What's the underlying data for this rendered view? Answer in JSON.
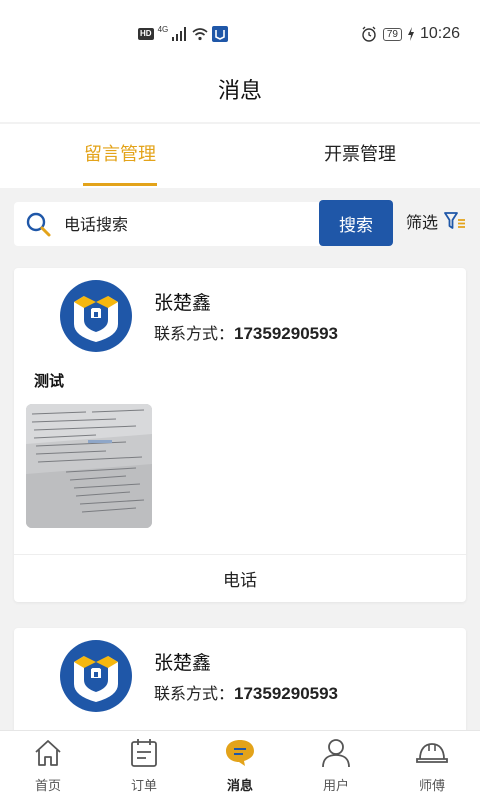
{
  "status_bar": {
    "hd": "HD",
    "network": "4G",
    "battery": "79",
    "time": "10:26"
  },
  "header": {
    "title": "消息"
  },
  "tabs": [
    {
      "label": "留言管理",
      "active": true
    },
    {
      "label": "开票管理",
      "active": false
    }
  ],
  "search": {
    "placeholder": "电话搜索",
    "button_label": "搜索",
    "filter_label": "筛选"
  },
  "cards": [
    {
      "name": "张楚鑫",
      "contact_label": "联系方式：",
      "phone": "17359290593",
      "message": "测试",
      "call_label": "电话"
    },
    {
      "name": "张楚鑫",
      "contact_label": "联系方式：",
      "phone": "17359290593"
    }
  ],
  "bottom_nav": [
    {
      "label": "首页",
      "icon": "home-icon",
      "active": false
    },
    {
      "label": "订单",
      "icon": "order-icon",
      "active": false
    },
    {
      "label": "消息",
      "icon": "message-icon",
      "active": true
    },
    {
      "label": "用户",
      "icon": "user-icon",
      "active": false
    },
    {
      "label": "师傅",
      "icon": "worker-helmet-icon",
      "active": false
    }
  ],
  "colors": {
    "accent": "#e3a31a",
    "brand_blue": "#1f57a8",
    "avatar_yellow": "#f5b70f"
  }
}
